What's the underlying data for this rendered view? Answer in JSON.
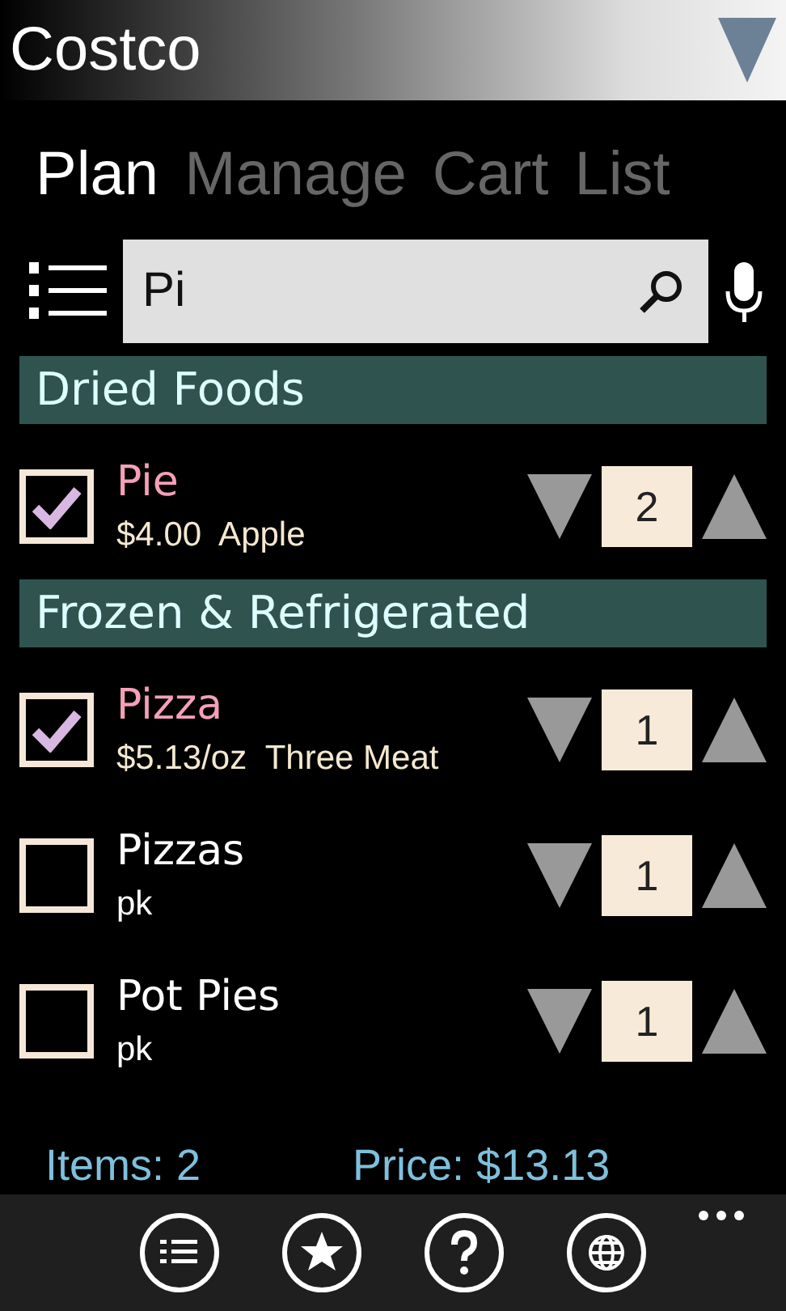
{
  "header": {
    "title": "Costco"
  },
  "tabs": [
    {
      "label": "Plan",
      "selected": true
    },
    {
      "label": "Manage",
      "selected": false
    },
    {
      "label": "Cart",
      "selected": false
    },
    {
      "label": "List",
      "selected": false
    }
  ],
  "search": {
    "value": "Pi"
  },
  "sections": [
    {
      "title": "Dried Foods",
      "items": [
        {
          "name": "Pie",
          "detail": "$4.00  Apple",
          "checked": true,
          "quantity": "2"
        }
      ]
    },
    {
      "title": "Frozen & Refrigerated",
      "items": [
        {
          "name": "Pizza",
          "detail": "$5.13/oz  Three Meat",
          "checked": true,
          "quantity": "1"
        },
        {
          "name": "Pizzas",
          "detail": "pk",
          "checked": false,
          "quantity": "1"
        },
        {
          "name": "Pot Pies",
          "detail": "pk",
          "checked": false,
          "quantity": "1"
        }
      ]
    }
  ],
  "summary": {
    "items": "Items: 2",
    "price": "Price:  $13.13"
  }
}
